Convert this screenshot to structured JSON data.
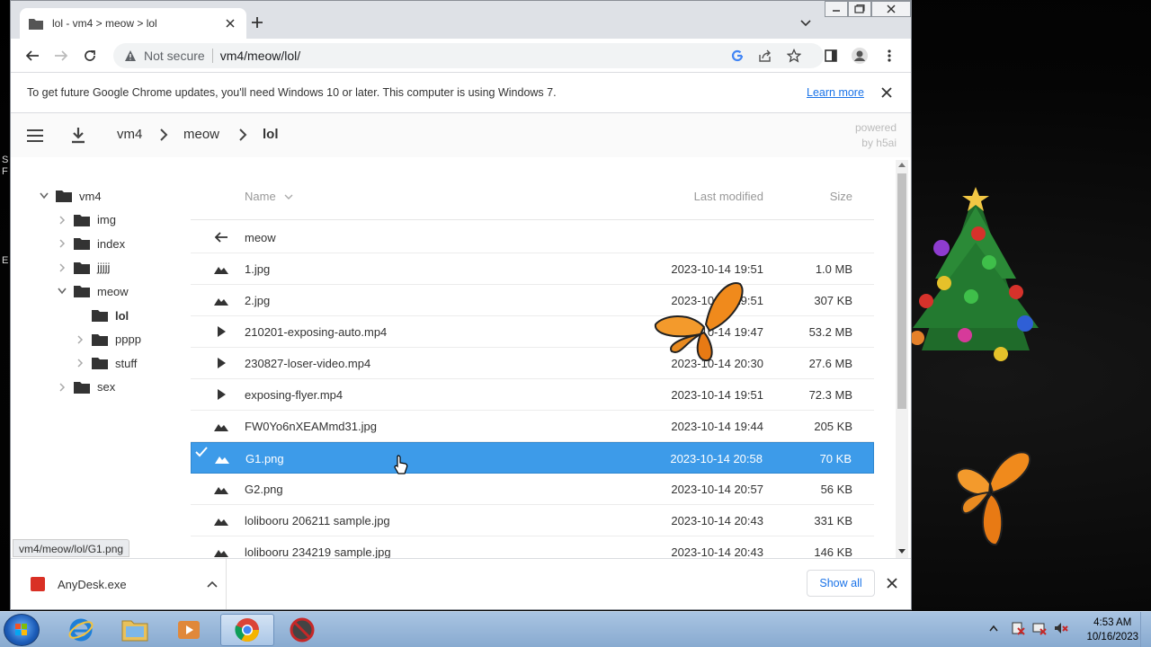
{
  "browser": {
    "tab_title": "lol - vm4 > meow > lol",
    "security_label": "Not secure",
    "url": "vm4/meow/lol/",
    "infobar_message": "To get future Google Chrome updates, you'll need Windows 10 or later. This computer is using Windows 7.",
    "infobar_link": "Learn more",
    "status_url": "vm4/meow/lol/G1.png"
  },
  "h5ai": {
    "breadcrumbs": [
      "vm4",
      "meow",
      "lol"
    ],
    "powered_line1": "powered",
    "powered_line2": "by h5ai",
    "tree": [
      {
        "label": "vm4",
        "level": 0,
        "expanded": true
      },
      {
        "label": "img",
        "level": 1,
        "expanded": false
      },
      {
        "label": "index",
        "level": 1,
        "expanded": false
      },
      {
        "label": "jjjjj",
        "level": 1,
        "expanded": false
      },
      {
        "label": "meow",
        "level": 1,
        "expanded": true
      },
      {
        "label": "lol",
        "level": 2,
        "current": true
      },
      {
        "label": "pppp",
        "level": 2,
        "expanded": false
      },
      {
        "label": "stuff",
        "level": 2,
        "expanded": false
      },
      {
        "label": "sex",
        "level": 1,
        "expanded": false
      }
    ],
    "headers": {
      "name": "Name",
      "modified": "Last modified",
      "size": "Size"
    },
    "parent_label": "meow",
    "files": [
      {
        "name": "1.jpg",
        "modified": "2023-10-14 19:51",
        "size": "1.0 MB",
        "icon": "image-icon"
      },
      {
        "name": "2.jpg",
        "modified": "2023-10-14 19:51",
        "size": "307 KB",
        "icon": "image-icon"
      },
      {
        "name": "210201-exposing-auto.mp4",
        "modified": "2023-10-14 19:47",
        "size": "53.2 MB",
        "icon": "video-icon"
      },
      {
        "name": "230827-loser-video.mp4",
        "modified": "2023-10-14 20:30",
        "size": "27.6 MB",
        "icon": "video-icon"
      },
      {
        "name": "exposing-flyer.mp4",
        "modified": "2023-10-14 19:51",
        "size": "72.3 MB",
        "icon": "video-icon"
      },
      {
        "name": "FW0Yo6nXEAMmd31.jpg",
        "modified": "2023-10-14 19:44",
        "size": "205 KB",
        "icon": "image-icon"
      },
      {
        "name": "G1.png",
        "modified": "2023-10-14 20:58",
        "size": "70 KB",
        "icon": "image-icon",
        "selected": true
      },
      {
        "name": "G2.png",
        "modified": "2023-10-14 20:57",
        "size": "56 KB",
        "icon": "image-icon"
      },
      {
        "name": "lolibooru 206211 sample.jpg",
        "modified": "2023-10-14 20:43",
        "size": "331 KB",
        "icon": "image-icon"
      },
      {
        "name": "lolibooru 234219 sample.jpg",
        "modified": "2023-10-14 20:43",
        "size": "146 KB",
        "icon": "image-icon"
      }
    ]
  },
  "downloads": {
    "item": "AnyDesk.exe",
    "show_all": "Show all"
  },
  "taskbar": {
    "time": "4:53 AM",
    "date": "10/16/2023"
  },
  "colors": {
    "selection": "#3d9be9",
    "link": "#1a73e8"
  }
}
